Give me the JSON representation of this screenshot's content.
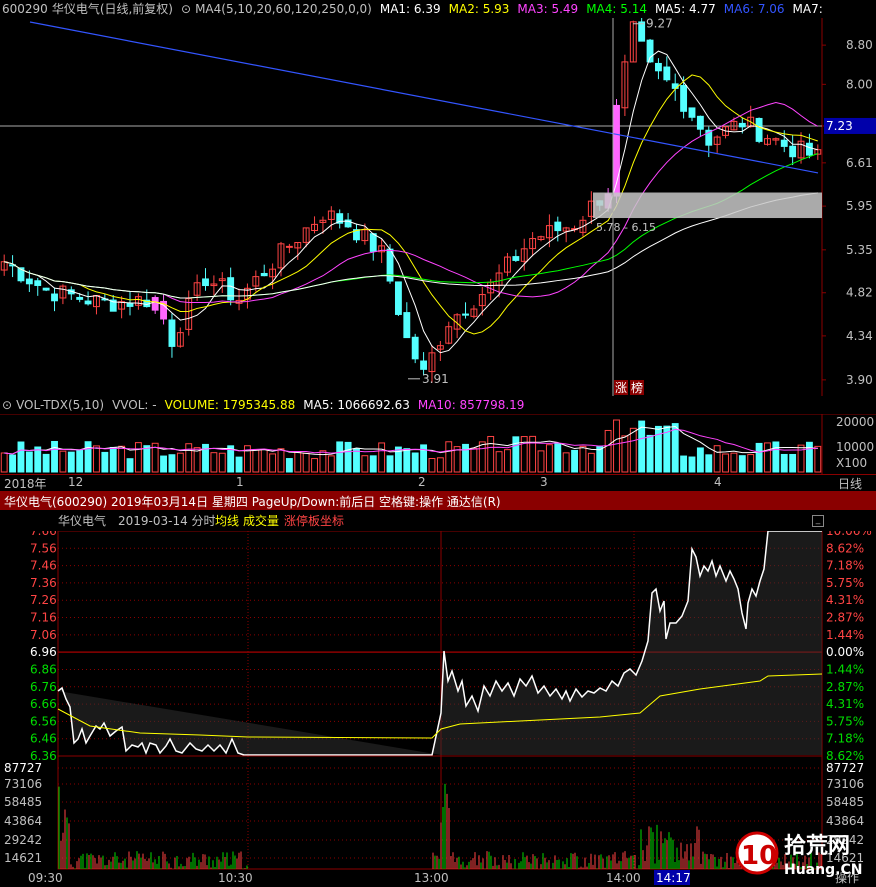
{
  "colors": {
    "up": "#ff4444",
    "down": "#54ffff",
    "ma1": "#ffffff",
    "ma2": "#ffff00",
    "ma3": "#ff44ff",
    "ma4": "#00ff00",
    "ma5": "#ffffff",
    "ma6": "#3355ff",
    "grid": "#8b0000",
    "limit_up": "#ff66ff",
    "zone": "#c8c8c8"
  },
  "kline": {
    "code": "600290",
    "name": "华仪电气(日线,前复权)",
    "ma_settings": "MA4(5,10,20,60,120,250,0,0)",
    "ma1": "MA1: 6.39",
    "ma2": "MA2: 5.93",
    "ma3": "MA3: 5.49",
    "ma4": "MA4: 5.14",
    "ma5": "MA5: 4.77",
    "ma6": "MA6: 7.06",
    "ma7": "MA7:",
    "y_ticks": [
      "8.80",
      "8.00",
      "7.23",
      "6.61",
      "5.95",
      "5.35",
      "4.82",
      "4.34",
      "3.90"
    ],
    "y_values": [
      8.8,
      8.0,
      7.23,
      6.61,
      5.95,
      5.35,
      4.82,
      4.34,
      3.9
    ],
    "high_label": "9.27",
    "low_label": "3.91",
    "zone_label": "5.78 - 6.15",
    "limit_tag_1": "涨",
    "limit_tag_2": "榜"
  },
  "vol": {
    "title": "VOL-TDX(5,10)",
    "vvol": "VVOL: -",
    "volume": "VOLUME: 1795345.88",
    "ma5": "MA5: 1066692.63",
    "ma10": "MA10: 857798.19",
    "y_ticks": [
      "20000",
      "10000",
      "X100"
    ]
  },
  "timeline": {
    "x_labels": [
      "2018年",
      "12",
      "1",
      "2",
      "3",
      "4"
    ],
    "period": "日线"
  },
  "intraday": {
    "header": "华仪电气(600290) 2019年03月14日 星期四 PageUp/Down:前后日 空格键:操作 通达信(R)",
    "subtitle_name": "华仪电气",
    "subtitle_date": "2019-03-14 分时",
    "legend_avg": "均线",
    "legend_vol": "成交量",
    "legend_limit": "涨停板坐标",
    "left_ticks": [
      "7.66",
      "7.56",
      "7.46",
      "7.36",
      "7.26",
      "7.16",
      "7.06",
      "6.96",
      "6.86",
      "6.76",
      "6.66",
      "6.56",
      "6.46",
      "6.36"
    ],
    "right_ticks": [
      "10.06%",
      "8.62%",
      "7.18%",
      "5.75%",
      "4.31%",
      "2.87%",
      "1.44%",
      "0.00%",
      "1.44%",
      "2.87%",
      "4.31%",
      "5.75%",
      "7.18%",
      "8.62%"
    ],
    "prev_close": 6.96,
    "vol_ticks": [
      "87727",
      "73106",
      "58485",
      "43864",
      "29242",
      "14621"
    ],
    "time_labels": [
      "09:30",
      "10:30",
      "13:00",
      "14:00"
    ],
    "cursor_time": "14:17",
    "watermark_num": "10",
    "watermark_text": "拾荒网",
    "watermark_url": "Huang.CN",
    "ops": "操作"
  }
}
